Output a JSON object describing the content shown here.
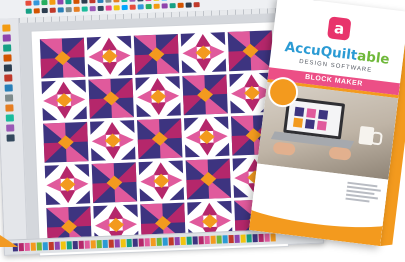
{
  "product": {
    "logo_letter": "a",
    "brand_name_main": "AccuQuilt",
    "brand_name_accent": "able",
    "subtitle": "DESIGN SOFTWARE",
    "band_title": "BLOCK MAKER"
  },
  "colors": {
    "quilt_navy": "#3d3480",
    "quilt_magenta": "#b5276b",
    "quilt_pink": "#e05a9c",
    "quilt_orange": "#f39a1e",
    "brand_blue": "#2b9bd4",
    "brand_green": "#6fb83a",
    "band_pink": "#ec4f86",
    "logo_pink": "#e8336b"
  },
  "icons": [
    "toolbar-tool-icon",
    "side-tool-icon",
    "logo-a-icon",
    "coffee-mug-icon",
    "laptop-icon"
  ],
  "quilt": {
    "rows": 5,
    "cols": 5
  }
}
